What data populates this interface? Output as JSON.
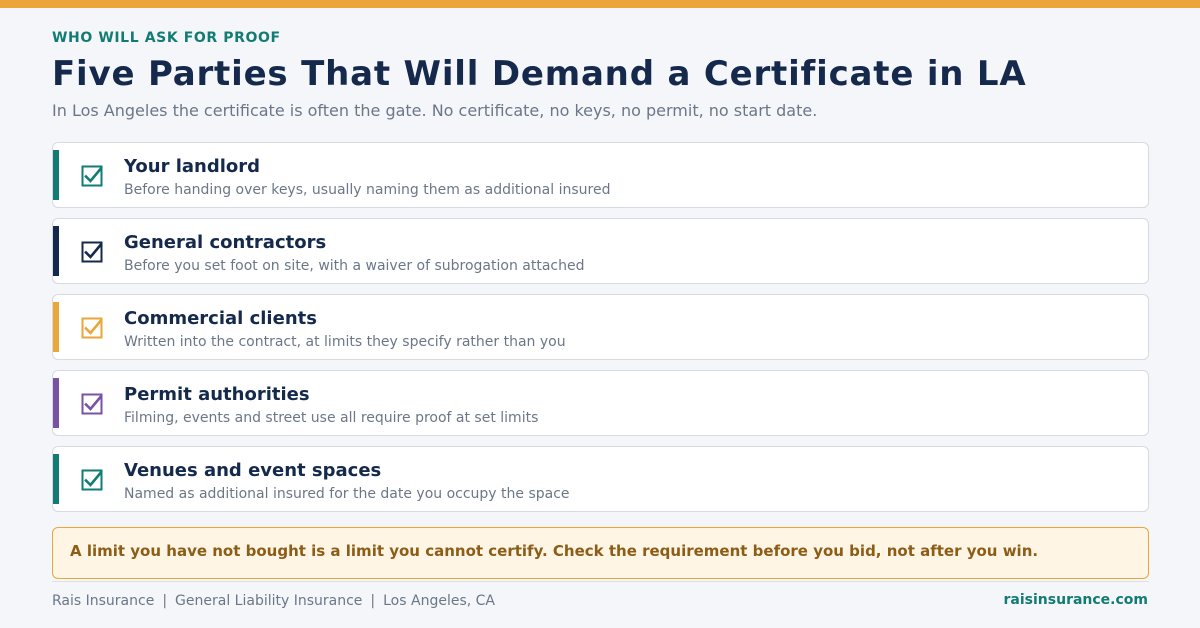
{
  "header": {
    "eyebrow": "WHO WILL ASK FOR PROOF",
    "title": "Five Parties That Will Demand a Certificate in LA",
    "subtitle": "In Los Angeles the certificate is often the gate. No certificate, no keys, no permit, no start date."
  },
  "colors": {
    "accent_bar": "#eba63a",
    "teal": "#127c74",
    "navy": "#14294b",
    "orange": "#eba63a",
    "purple": "#7a52a3"
  },
  "parties": [
    {
      "label": "Your landlord",
      "description": "Before handing over keys, usually naming them as additional insured",
      "color": "#127c74",
      "icon": "checkbox-checked-icon"
    },
    {
      "label": "General contractors",
      "description": "Before you set foot on site, with a waiver of subrogation attached",
      "color": "#14294b",
      "icon": "checkbox-checked-icon"
    },
    {
      "label": "Commercial clients",
      "description": "Written into the contract, at limits they specify rather than you",
      "color": "#eba63a",
      "icon": "checkbox-checked-icon"
    },
    {
      "label": "Permit authorities",
      "description": "Filming, events and street use all require proof at set limits",
      "color": "#7a52a3",
      "icon": "checkbox-checked-icon"
    },
    {
      "label": "Venues and event spaces",
      "description": "Named as additional insured for the date you occupy the space",
      "color": "#127c74",
      "icon": "checkbox-checked-icon"
    }
  ],
  "callout": {
    "text": "A limit you have not bought is a limit you cannot certify. Check the requirement before you bid, not after you win."
  },
  "footer": {
    "company": "Rais Insurance",
    "separator": "|",
    "product": "General Liability Insurance",
    "location": "Los Angeles, CA",
    "website": "raisinsurance.com"
  }
}
